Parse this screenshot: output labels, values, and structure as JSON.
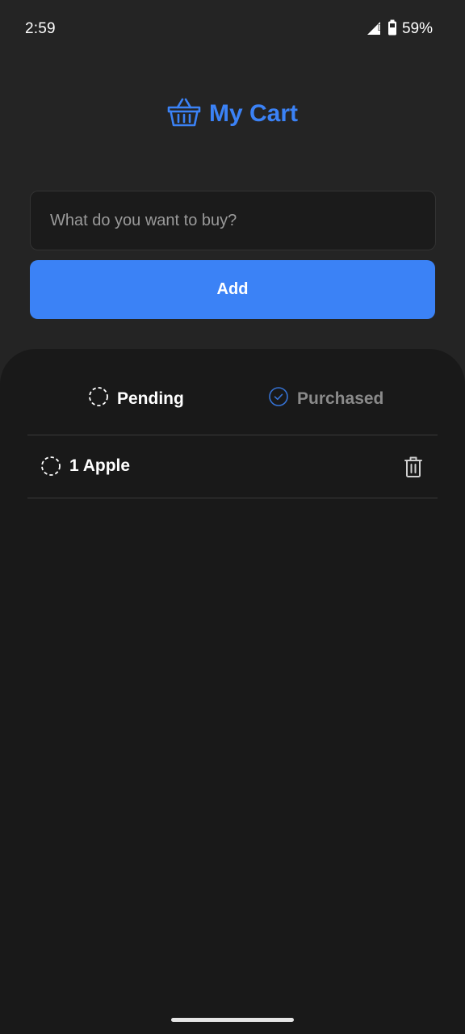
{
  "status_bar": {
    "time": "2:59",
    "battery": "59%",
    "icons": [
      "signal-icon",
      "battery-icon"
    ]
  },
  "header": {
    "icon": "basket-icon",
    "title": "My Cart",
    "accent_color": "#3b82f6"
  },
  "form": {
    "input_placeholder": "What do you want to buy?",
    "input_value": "",
    "add_label": "Add"
  },
  "tabs": [
    {
      "label": "Pending",
      "icon": "dashed-circle-icon",
      "active": true
    },
    {
      "label": "Purchased",
      "icon": "check-circle-icon",
      "active": false
    }
  ],
  "items": [
    {
      "label": "1 Apple",
      "status": "pending",
      "icon": "dashed-circle-icon",
      "action_icon": "trash-icon"
    }
  ]
}
